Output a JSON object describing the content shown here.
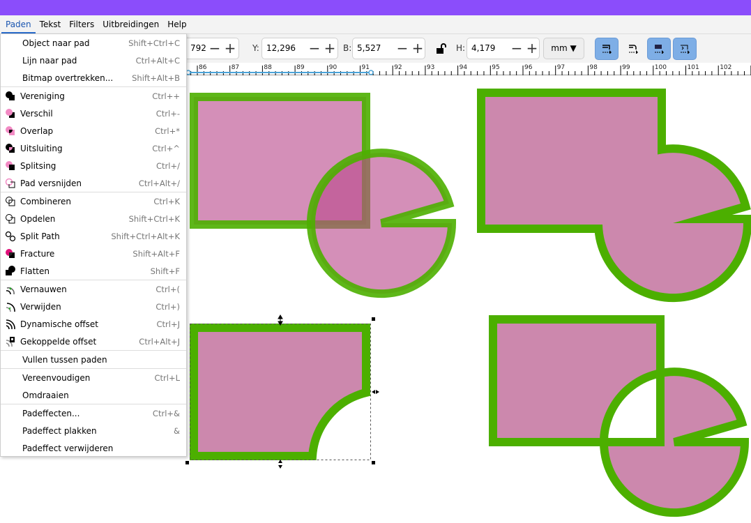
{
  "menubar": [
    "Paden",
    "Tekst",
    "Filters",
    "Uitbreidingen",
    "Help"
  ],
  "toolbar": {
    "x_value": "792",
    "y_label": "Y:",
    "y_value": "12,296",
    "b_label": "B:",
    "b_value": "5,527",
    "h_label": "H:",
    "h_value": "4,179",
    "unit": "mm"
  },
  "ruler": [
    "86",
    "87",
    "88",
    "89",
    "90",
    "91",
    "92",
    "93",
    "94",
    "95",
    "96",
    "97",
    "98",
    "99",
    "100",
    "101",
    "102"
  ],
  "menu": [
    [
      {
        "label": "Object naar pad",
        "shortcut": "Shift+Ctrl+C"
      },
      {
        "label": "Lijn naar pad",
        "shortcut": "Ctrl+Alt+C"
      },
      {
        "label": "Bitmap overtrekken...",
        "shortcut": "Shift+Alt+B"
      }
    ],
    [
      {
        "label": "Vereniging",
        "shortcut": "Ctrl++",
        "icon": "union-icon"
      },
      {
        "label": "Verschil",
        "shortcut": "Ctrl+-",
        "icon": "difference-icon"
      },
      {
        "label": "Overlap",
        "shortcut": "Ctrl+*",
        "icon": "intersection-icon"
      },
      {
        "label": "Uitsluiting",
        "shortcut": "Ctrl+^",
        "icon": "exclusion-icon"
      },
      {
        "label": "Splitsing",
        "shortcut": "Ctrl+/",
        "icon": "division-icon"
      },
      {
        "label": "Pad versnijden",
        "shortcut": "Ctrl+Alt+/",
        "icon": "cut-path-icon"
      }
    ],
    [
      {
        "label": "Combineren",
        "shortcut": "Ctrl+K",
        "icon": "combine-icon"
      },
      {
        "label": "Opdelen",
        "shortcut": "Shift+Ctrl+K",
        "icon": "break-apart-icon"
      },
      {
        "label": "Split Path",
        "shortcut": "Shift+Ctrl+Alt+K",
        "icon": "split-path-icon"
      },
      {
        "label": "Fracture",
        "shortcut": "Shift+Alt+F",
        "icon": "fracture-icon"
      },
      {
        "label": "Flatten",
        "shortcut": "Shift+F",
        "icon": "flatten-icon"
      }
    ],
    [
      {
        "label": "Vernauwen",
        "shortcut": "Ctrl+(",
        "icon": "inset-icon"
      },
      {
        "label": "Verwijden",
        "shortcut": "Ctrl+)",
        "icon": "outset-icon"
      },
      {
        "label": "Dynamische offset",
        "shortcut": "Ctrl+J",
        "icon": "dynamic-offset-icon"
      },
      {
        "label": "Gekoppelde offset",
        "shortcut": "Ctrl+Alt+J",
        "icon": "linked-offset-icon"
      }
    ],
    [
      {
        "label": "Vullen tussen paden",
        "shortcut": ""
      }
    ],
    [
      {
        "label": "Vereenvoudigen",
        "shortcut": "Ctrl+L"
      },
      {
        "label": "Omdraaien",
        "shortcut": ""
      }
    ],
    [
      {
        "label": "Padeffecten...",
        "shortcut": "Ctrl+&"
      },
      {
        "label": "Padeffect plakken",
        "shortcut": "&"
      },
      {
        "label": "Padeffect verwijderen",
        "shortcut": ""
      }
    ]
  ],
  "colors": {
    "accent": "#8b4dfb",
    "stroke": "#4caf00",
    "fill": "#cc88ad"
  }
}
